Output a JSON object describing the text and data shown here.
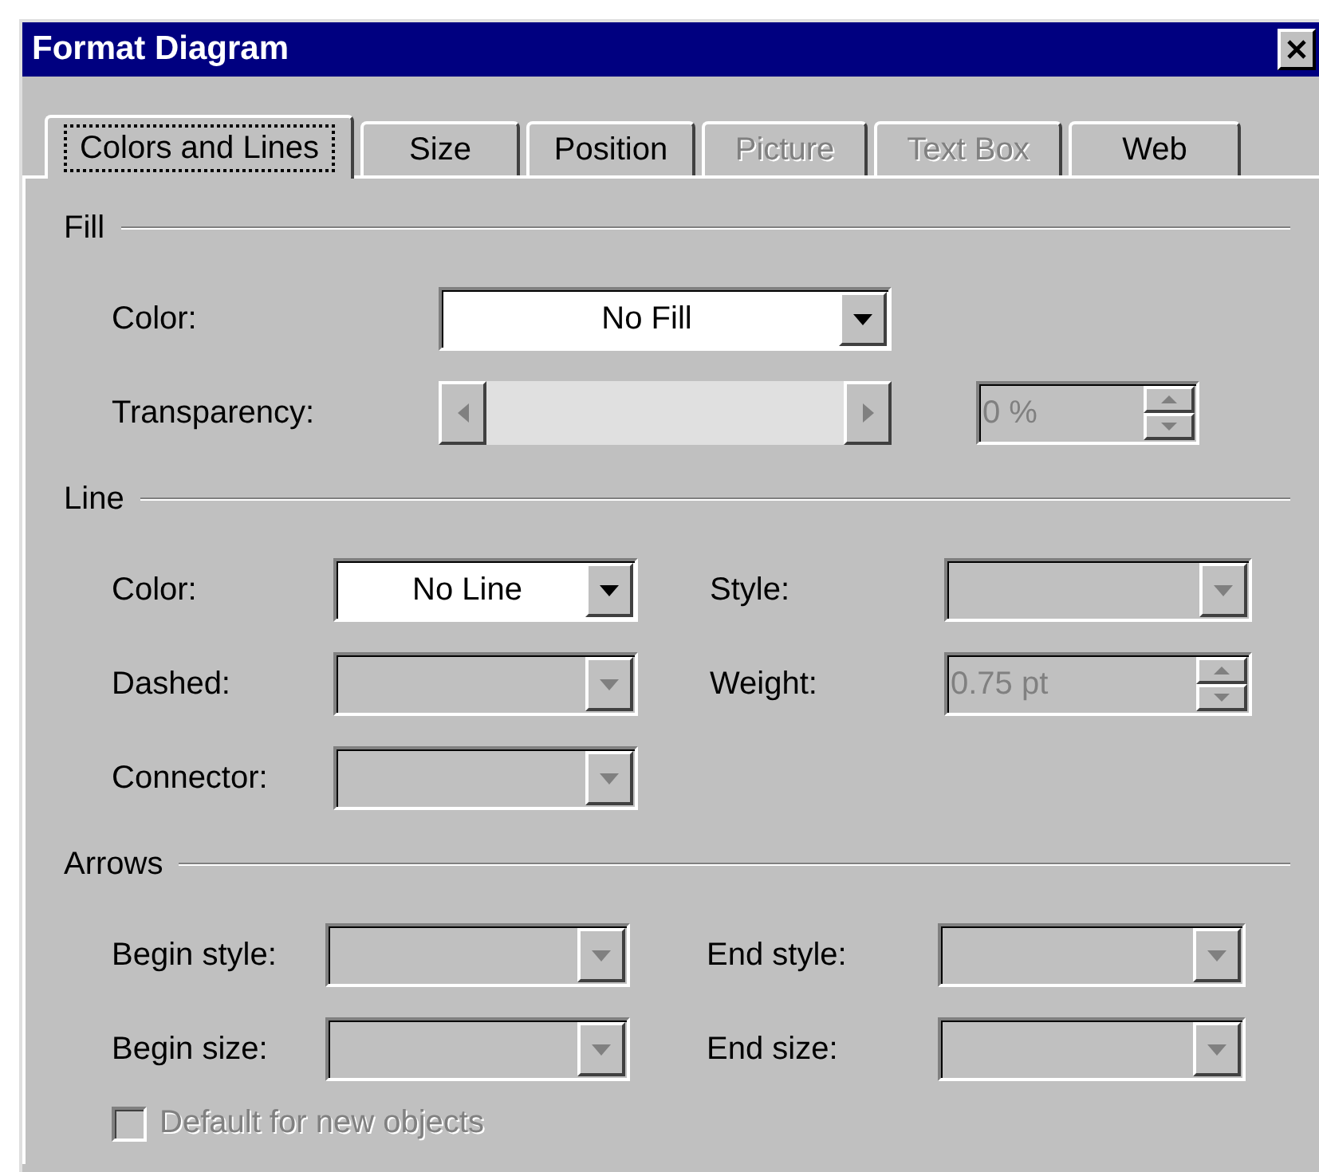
{
  "window": {
    "title": "Format Diagram"
  },
  "tabs": [
    {
      "label": "Colors and Lines",
      "selected": true,
      "disabled": false
    },
    {
      "label": "Size",
      "selected": false,
      "disabled": false
    },
    {
      "label": "Position",
      "selected": false,
      "disabled": false
    },
    {
      "label": "Picture",
      "selected": false,
      "disabled": true
    },
    {
      "label": "Text Box",
      "selected": false,
      "disabled": true
    },
    {
      "label": "Web",
      "selected": false,
      "disabled": false
    }
  ],
  "sections": [
    {
      "heading": "Fill",
      "rows": [
        [
          {
            "kind": "dropdown",
            "label": "Color:",
            "value": "No Fill",
            "disabled": false
          }
        ],
        [
          {
            "kind": "slider",
            "label": "Transparency:",
            "disabled": true
          },
          {
            "kind": "spinner",
            "value": "0 %",
            "disabled": true
          }
        ]
      ]
    },
    {
      "heading": "Line",
      "rows": [
        [
          {
            "kind": "dropdown",
            "label": "Color:",
            "value": "No Line",
            "disabled": false
          },
          {
            "kind": "dropdown",
            "label": "Style:",
            "disabled": true
          }
        ],
        [
          {
            "kind": "dropdown",
            "label": "Dashed:",
            "disabled": true
          },
          {
            "kind": "spinner",
            "label": "Weight:",
            "value": "0.75 pt",
            "disabled": true
          }
        ],
        [
          {
            "kind": "dropdown",
            "label": "Connector:",
            "disabled": true
          }
        ]
      ]
    },
    {
      "heading": "Arrows",
      "rows": [
        [
          {
            "kind": "dropdown",
            "label": "Begin style:",
            "disabled": true
          },
          {
            "kind": "dropdown",
            "label": "End style:",
            "disabled": true
          }
        ],
        [
          {
            "kind": "dropdown",
            "label": "Begin size:",
            "disabled": true
          },
          {
            "kind": "dropdown",
            "label": "End size:",
            "disabled": true
          }
        ]
      ]
    }
  ],
  "checkbox": {
    "label": "Default for new objects",
    "checked": false,
    "disabled": true
  }
}
